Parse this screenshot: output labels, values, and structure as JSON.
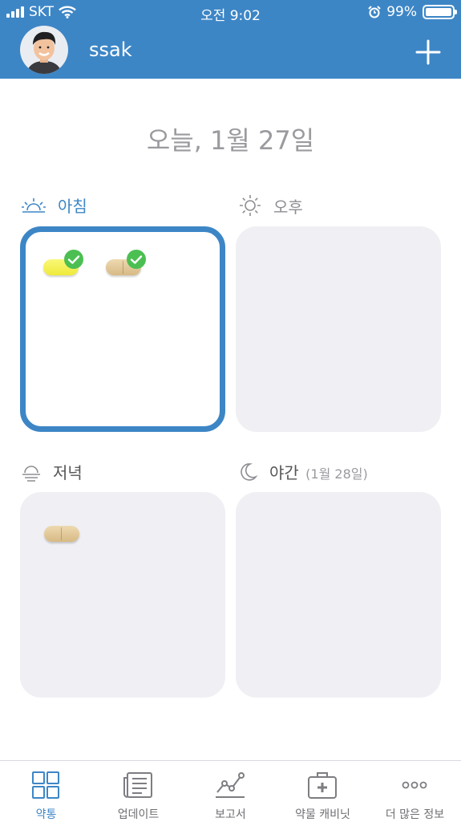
{
  "status_bar": {
    "carrier": "SKT",
    "time": "오전 9:02",
    "battery": "99%",
    "battery_level": 0.99
  },
  "header": {
    "username": "ssak",
    "accent_color": "#3d86c6"
  },
  "date_title": "오늘, 1월 27일",
  "slots": {
    "morning": {
      "label": "아침",
      "label_color": "#3d86c6",
      "icon": "sunrise-icon",
      "pills": [
        {
          "color": "yellow",
          "taken": true
        },
        {
          "color": "tan",
          "taken": true
        }
      ]
    },
    "afternoon": {
      "label": "오후",
      "icon": "sun-icon"
    },
    "evening": {
      "label": "저녁",
      "icon": "sunset-icon",
      "pills": [
        {
          "color": "tan",
          "taken": false
        }
      ]
    },
    "night": {
      "label": "야간",
      "sub": "(1월 28일)",
      "icon": "moon-icon"
    }
  },
  "tabs": [
    {
      "label": "약통",
      "icon": "grid-icon",
      "active": true
    },
    {
      "label": "업데이트",
      "icon": "newspaper-icon"
    },
    {
      "label": "보고서",
      "icon": "chart-line-icon"
    },
    {
      "label": "약물 캐비닛",
      "icon": "medkit-icon"
    },
    {
      "label": "더 많은 정보",
      "icon": "more-dots-icon"
    }
  ],
  "colors": {
    "accent": "#3d86c6",
    "card_bg": "#efeff4",
    "check_green": "#4cbf52"
  }
}
